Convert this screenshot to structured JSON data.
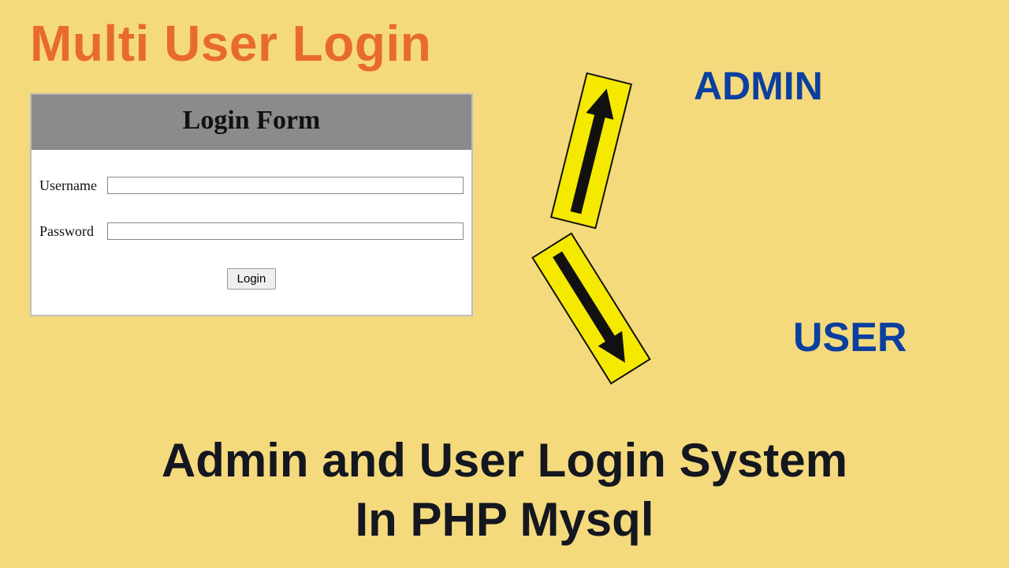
{
  "title": "Multi User Login",
  "login_form": {
    "heading": "Login Form",
    "username_label": "Username",
    "password_label": "Password",
    "button_label": "Login"
  },
  "roles": {
    "admin": "ADMIN",
    "user": "USER"
  },
  "caption_line1": "Admin and User Login System",
  "caption_line2": "In PHP Mysql"
}
